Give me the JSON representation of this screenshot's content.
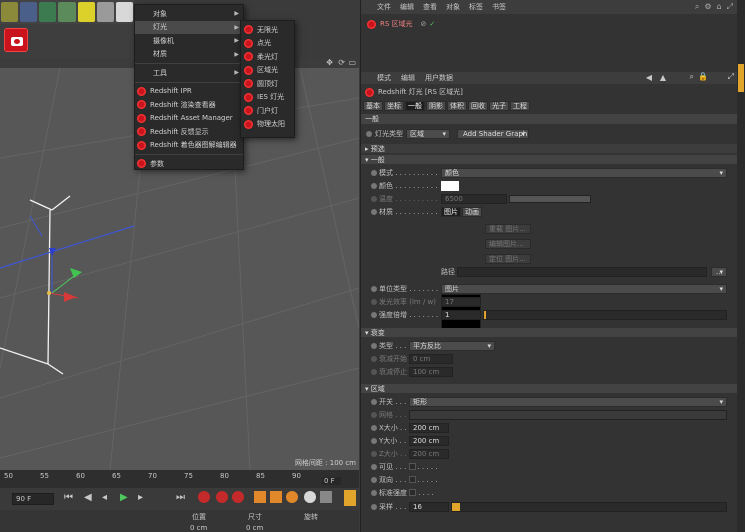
{
  "menus": {
    "main": [
      {
        "label": "对象",
        "submenu": true
      },
      {
        "label": "灯光",
        "submenu": true,
        "highlighted": true
      },
      {
        "label": "摄像机",
        "submenu": true
      },
      {
        "label": "材质",
        "submenu": true
      },
      {
        "label": "工具",
        "submenu": true
      },
      {
        "label": "Redshift IPR"
      },
      {
        "label": "Redshift 渲染查看器"
      },
      {
        "label": "Redshift Asset Manager"
      },
      {
        "label": "Redshift 反馈显示"
      },
      {
        "label": "Redshift 着色器图解编辑器"
      },
      {
        "label": "参数"
      }
    ],
    "lights": [
      "无限光",
      "点光",
      "柔光灯",
      "区域光",
      "圆顶灯",
      "IES 灯光",
      "门户灯",
      "物理太阳"
    ]
  },
  "viewport": {
    "grid_label": "网格间距 : 100 cm"
  },
  "timeline": {
    "ticks": [
      "50",
      "55",
      "60",
      "65",
      "70",
      "75",
      "80",
      "85",
      "90"
    ],
    "frame_field": "90 F",
    "current_frame": "0 F"
  },
  "coords": {
    "position": "位置",
    "size": "尺寸",
    "rotation": "旋转",
    "value": "0 cm"
  },
  "object_manager": {
    "menu": [
      "文件",
      "编辑",
      "查看",
      "对象",
      "标签",
      "书签"
    ],
    "object_name": "RS 区域光"
  },
  "attr": {
    "menu": [
      "模式",
      "编辑",
      "用户数据"
    ],
    "title": "Redshift 灯光 [RS 区域光]",
    "tabs": [
      "基本",
      "坐标",
      "一般",
      "阴影",
      "体积",
      "回收",
      "光子",
      "工程"
    ],
    "active_tab": "一般",
    "section_general": "一般",
    "light_type_label": "灯光类型",
    "light_type_value": "区域",
    "shader_graph_btn": "Add Shader Graph",
    "preset": "预选",
    "sub_general": "一般",
    "mode_label": "模式 . . . . . . . . . .",
    "mode_value": "颜色",
    "color_label": "颜色 . . . . . . . . . .",
    "temp_label": "温度 . . . . . . . . . .",
    "temp_value": "6500",
    "texture_label": "材质 . . . . . . . . . .",
    "tex_tabs": [
      "图片",
      "动画"
    ],
    "tex_btns": [
      "重载 图片...",
      "编辑图片...",
      "定位 图片..."
    ],
    "path_label": "路径",
    "path_btn": "...",
    "unit_label": "单位类型 . . . . . . . .",
    "unit_value": "图片",
    "efficacy_label": "发光效率 (lm / w)",
    "efficacy_value": "17",
    "intensity_label": "强度倍增 . . . . . . .",
    "intensity_value": "1",
    "falloff_section": "衰变",
    "falloff_type_label": "类型 . . . . . . . . . .",
    "falloff_type_value": "平方反比",
    "falloff_start_label": "衰减开始 . . . . . .",
    "falloff_start_value": "0 cm",
    "falloff_stop_label": "衰减停止 . . . . . .",
    "falloff_stop_value": "100 cm",
    "area_section": "区域",
    "switch_label": "开关 . . . . . . . . . .",
    "switch_value": "矩形",
    "mesh_label": "网格 . . . . . . . . . .",
    "x_label": "X大小 . . . . . . . . .",
    "x_value": "200 cm",
    "y_label": "Y大小 . . . . . . . . .",
    "y_value": "200 cm",
    "z_label": "Z大小 . . . . . . . . .",
    "z_value": "200 cm",
    "visible_label": "可见 . . . . . . . . . .",
    "double_label": "双向 . . . . . . . . . .",
    "normalize_label": "标准强度 . . . . . .",
    "samples_label": "采样 . . . . . . . . . .",
    "samples_value": "16"
  },
  "colors": {
    "redshift": "#c9141e",
    "accent_blue": "#2d6ab0"
  }
}
